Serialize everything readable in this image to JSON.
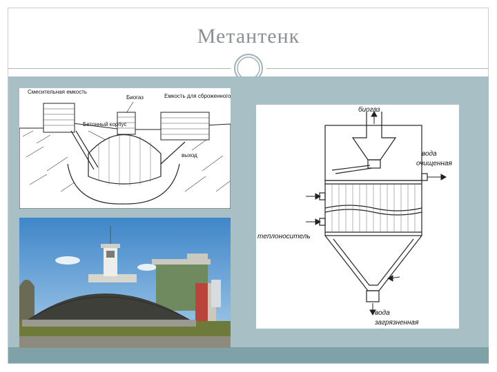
{
  "slide": {
    "title": "Метантенк"
  },
  "diagram_top_left": {
    "labels": {
      "mixing_tank": "Смесительная емкость",
      "biogas": "Биогаз",
      "residue_tank": "Емкость для сброженного остатка",
      "concrete_body": "Бетонный корпус",
      "outlet": "выход"
    }
  },
  "diagram_right": {
    "labels": {
      "biogas": "биогаз",
      "clean_water_1": "вода",
      "clean_water_2": "очищенная",
      "heat_carrier": "теплоноситель",
      "dirty_water_1": "вода",
      "dirty_water_2": "загрязненная"
    }
  },
  "photo": {
    "description_icon": "digester-photo"
  }
}
